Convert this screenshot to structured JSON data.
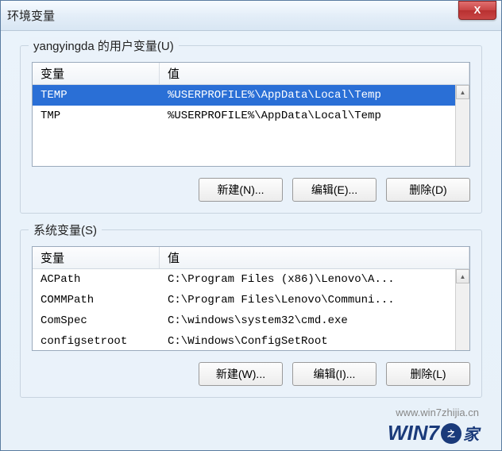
{
  "window": {
    "title": "环境变量",
    "close_label": "X"
  },
  "user_vars": {
    "group_label": "yangyingda 的用户变量(U)",
    "col_variable": "变量",
    "col_value": "值",
    "rows": [
      {
        "name": "TEMP",
        "value": "%USERPROFILE%\\AppData\\Local\\Temp",
        "selected": true
      },
      {
        "name": "TMP",
        "value": "%USERPROFILE%\\AppData\\Local\\Temp",
        "selected": false
      }
    ],
    "buttons": {
      "new": "新建(N)...",
      "edit": "编辑(E)...",
      "delete": "删除(D)"
    }
  },
  "system_vars": {
    "group_label": "系统变量(S)",
    "col_variable": "变量",
    "col_value": "值",
    "rows": [
      {
        "name": "ACPath",
        "value": "C:\\Program Files (x86)\\Lenovo\\A..."
      },
      {
        "name": "COMMPath",
        "value": "C:\\Program Files\\Lenovo\\Communi..."
      },
      {
        "name": "ComSpec",
        "value": "C:\\windows\\system32\\cmd.exe"
      },
      {
        "name": "configsetroot",
        "value": "C:\\Windows\\ConfigSetRoot"
      }
    ],
    "buttons": {
      "new": "新建(W)...",
      "edit": "编辑(I)...",
      "delete": "删除(L)"
    }
  },
  "watermark": {
    "url": "www.win7zhijia.cn",
    "logo_text_prefix": "WIN",
    "logo_text_seven": "7",
    "logo_badge": "之",
    "logo_suffix": "家"
  }
}
